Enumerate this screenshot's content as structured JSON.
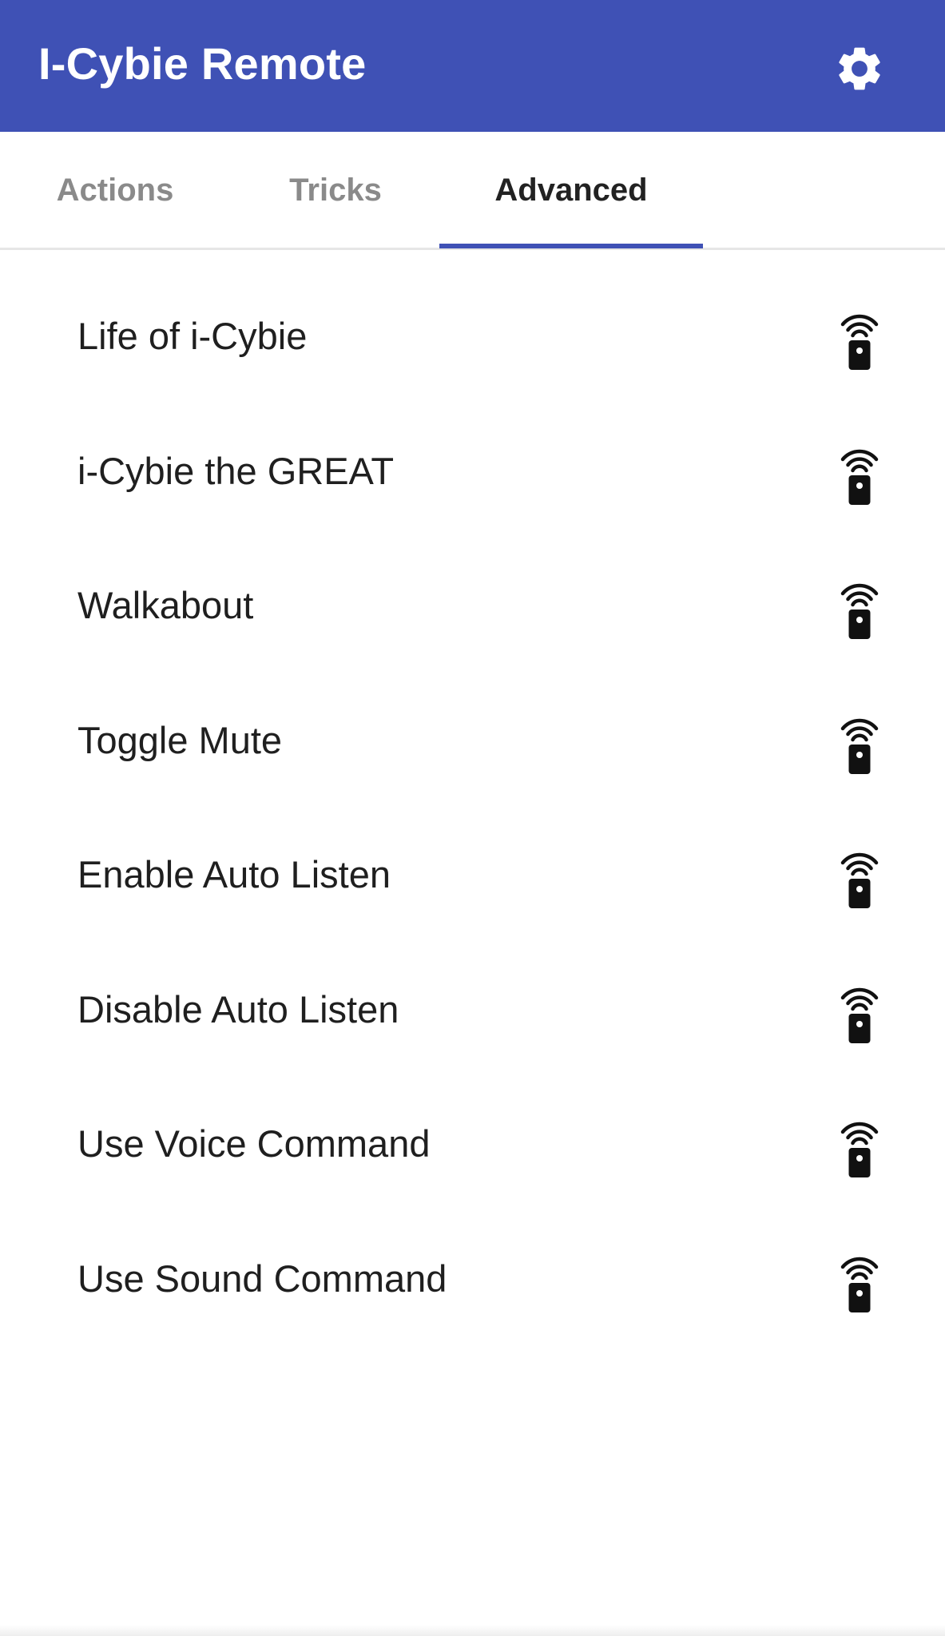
{
  "app_bar": {
    "title": "I-Cybie Remote",
    "settings_icon": "gear-icon",
    "background_color": "#3f51b5"
  },
  "tabs": [
    {
      "label": "Actions",
      "active": false
    },
    {
      "label": "Tricks",
      "active": false
    },
    {
      "label": "Advanced",
      "active": true
    }
  ],
  "accent_color": "#3f51b5",
  "items": [
    {
      "label": "Life of i-Cybie",
      "icon": "remote-control-icon"
    },
    {
      "label": "i-Cybie the GREAT",
      "icon": "remote-control-icon"
    },
    {
      "label": "Walkabout",
      "icon": "remote-control-icon"
    },
    {
      "label": "Toggle Mute",
      "icon": "remote-control-icon"
    },
    {
      "label": "Enable Auto Listen",
      "icon": "remote-control-icon"
    },
    {
      "label": "Disable Auto Listen",
      "icon": "remote-control-icon"
    },
    {
      "label": "Use Voice Command",
      "icon": "remote-control-icon"
    },
    {
      "label": "Use Sound Command",
      "icon": "remote-control-icon"
    }
  ]
}
